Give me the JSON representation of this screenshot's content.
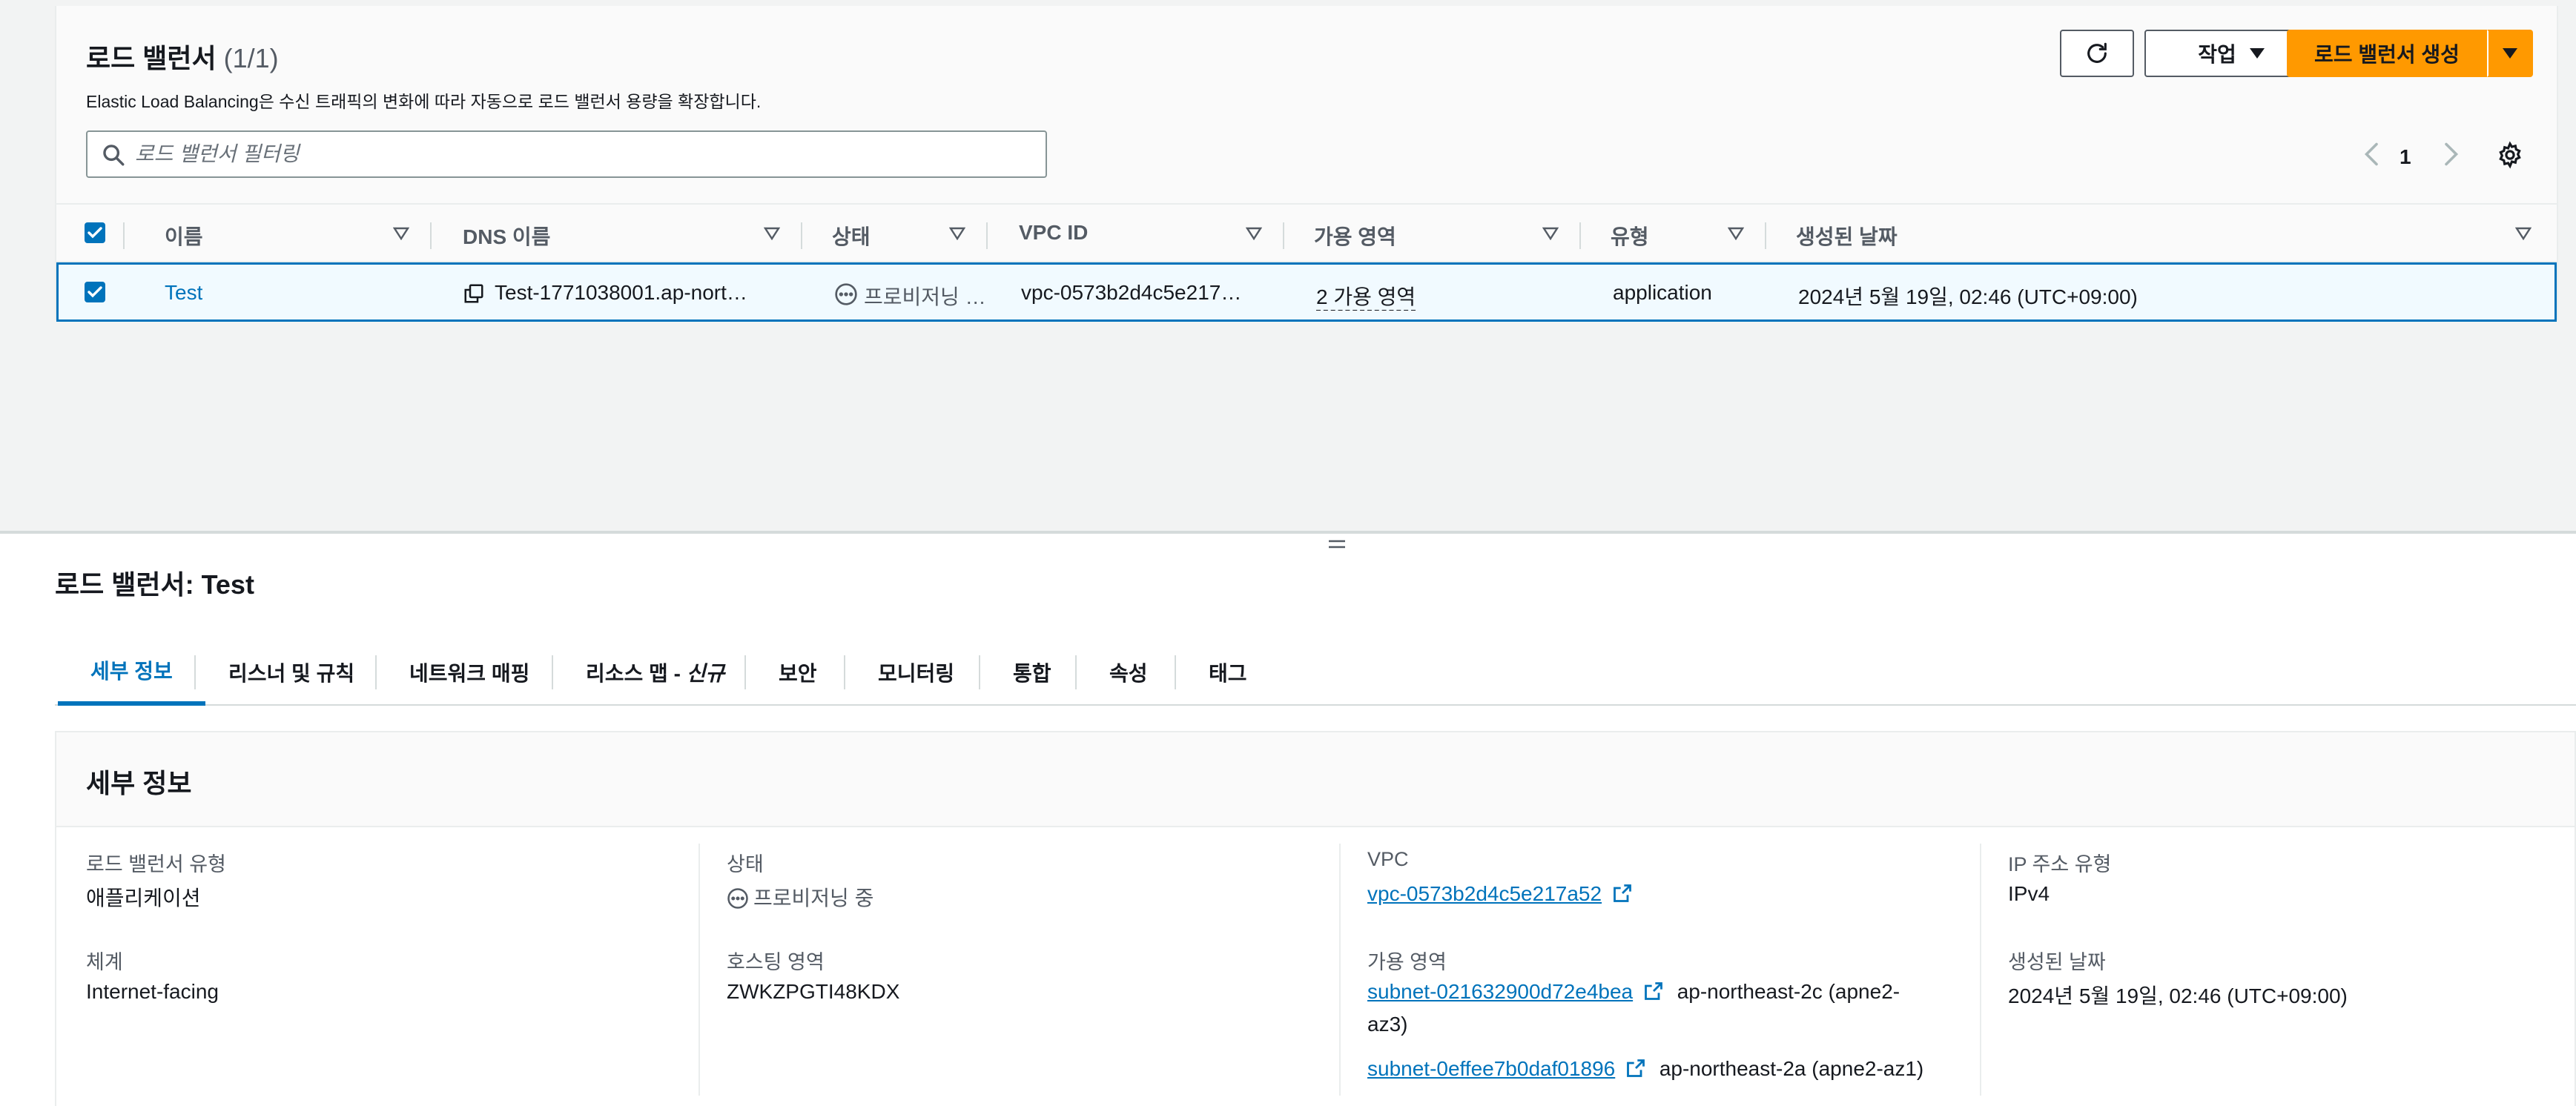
{
  "list": {
    "title": "로드 밸런서",
    "count": "(1/1)",
    "description": "Elastic Load Balancing은 수신 트래픽의 변화에 따라 자동으로 로드 밸런서 용량을 확장합니다.",
    "actions_label": "작업",
    "create_label": "로드 밸런서 생성",
    "search_placeholder": "로드 밸런서 필터링",
    "page": "1",
    "columns": [
      "이름",
      "DNS 이름",
      "상태",
      "VPC ID",
      "가용 영역",
      "유형",
      "생성된 날짜"
    ],
    "row": {
      "name": "Test",
      "dns": "Test-1771038001.ap-nort…",
      "status": "프로비저닝 중…",
      "vpc": "vpc-0573b2d4c5e217…",
      "az": "2 가용 영역",
      "type": "application",
      "created": "2024년 5월 19일, 02:46 (UTC+09:00)"
    }
  },
  "detail": {
    "title": "로드 밸런서: Test",
    "tabs": [
      "세부 정보",
      "리스너 및 규칙",
      "네트워크 매핑",
      "리소스 맵 - ",
      "신규",
      "보안",
      "모니터링",
      "통합",
      "속성",
      "태그"
    ],
    "section_heading": "세부 정보",
    "fields": {
      "lb_type_label": "로드 밸런서 유형",
      "lb_type_value": "애플리케이션",
      "scheme_label": "체계",
      "scheme_value": "Internet-facing",
      "status_label": "상태",
      "status_value": "프로비저닝 중",
      "hosted_zone_label": "호스팅 영역",
      "hosted_zone_value": "ZWKZPGTI48KDX",
      "vpc_label": "VPC",
      "vpc_value": "vpc-0573b2d4c5e217a52",
      "az_label": "가용 영역",
      "subnet1": "subnet-021632900d72e4bea",
      "subnet1_zone": "ap-northeast-2c (apne2-",
      "subnet1_zone_cont": "az3)",
      "subnet2": "subnet-0effee7b0daf01896",
      "subnet2_zone": "ap-northeast-2a (apne2-az1)",
      "ip_type_label": "IP 주소 유형",
      "ip_type_value": "IPv4",
      "created_label": "생성된 날짜",
      "created_value": "2024년 5월 19일, 02:46 (UTC+09:00)"
    }
  },
  "colors": {
    "accent": "#0073bb",
    "primary_button": "#ff9900",
    "text": "#16191f",
    "muted": "#545b64"
  }
}
